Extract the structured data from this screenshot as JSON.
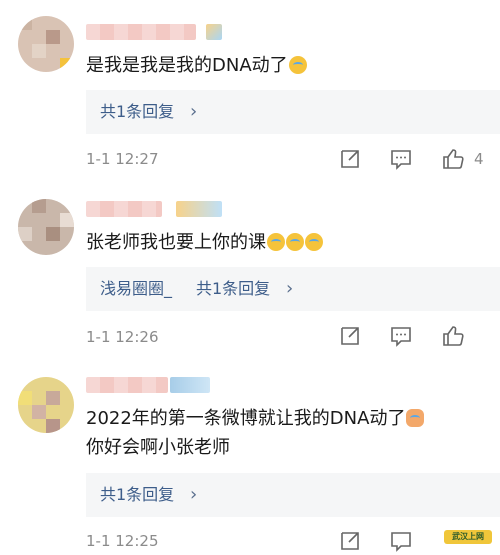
{
  "comments": [
    {
      "text": "是我是我是我的DNA动了",
      "emoji": [
        "crying-laughing"
      ],
      "replies_label": "共1条回复",
      "replies_prefix": "",
      "time": "1-1 12:27",
      "likes": "4"
    },
    {
      "text": "张老师我也要上你的课",
      "emoji": [
        "crying-laughing",
        "crying-laughing",
        "crying-laughing"
      ],
      "replies_label": "共1条回复",
      "replies_prefix": "浅易圈圈_",
      "time": "1-1 12:26",
      "likes": ""
    },
    {
      "text": "2022年的第一条微博就让我的DNA动了",
      "text2": "你好会啊小张老师",
      "emoji": [
        "cat"
      ],
      "replies_label": "共1条回复",
      "replies_prefix": "",
      "time": "1-1 12:25",
      "likes": ""
    }
  ],
  "icons": [
    "share-icon",
    "comment-icon",
    "like-icon"
  ],
  "colors": {
    "link": "#3d5d8a",
    "meta": "#8b8b8b",
    "reply_bg": "#f5f6f7"
  },
  "watermark": "武汉上网"
}
